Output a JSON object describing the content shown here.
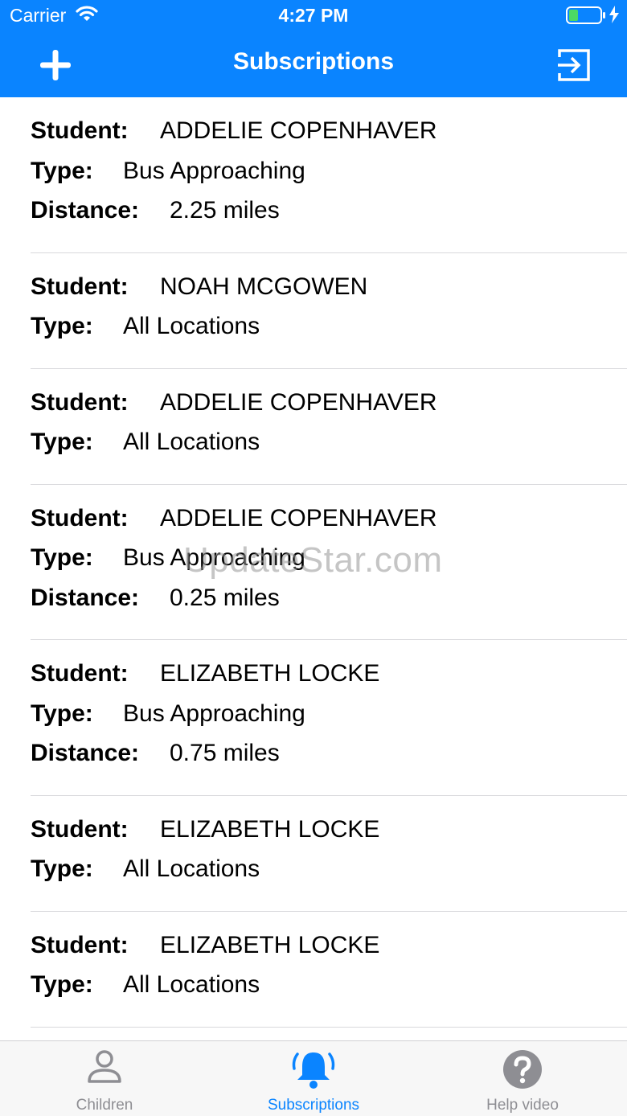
{
  "status_bar": {
    "carrier": "Carrier",
    "time": "4:27 PM"
  },
  "nav": {
    "title": "Subscriptions",
    "add_icon": "plus-icon",
    "exit_icon": "sign-in-icon"
  },
  "labels": {
    "student": "Student:",
    "type": "Type:",
    "distance": "Distance:"
  },
  "subscriptions": [
    {
      "student": "ADDELIE COPENHAVER",
      "type": "Bus Approaching",
      "distance": "2.25 miles"
    },
    {
      "student": "NOAH MCGOWEN",
      "type": "All Locations"
    },
    {
      "student": "ADDELIE COPENHAVER",
      "type": "All Locations"
    },
    {
      "student": "ADDELIE COPENHAVER",
      "type": "Bus Approaching",
      "distance": "0.25 miles"
    },
    {
      "student": "ELIZABETH LOCKE",
      "type": "Bus Approaching",
      "distance": "0.75 miles"
    },
    {
      "student": "ELIZABETH LOCKE",
      "type": "All Locations"
    },
    {
      "student": "ELIZABETH LOCKE",
      "type": "All Locations"
    }
  ],
  "watermark": "UpdateStar.com",
  "tabs": [
    {
      "label": "Children",
      "icon": "person-icon",
      "active": false
    },
    {
      "label": "Subscriptions",
      "icon": "bell-icon",
      "active": true
    },
    {
      "label": "Help video",
      "icon": "question-icon",
      "active": false
    }
  ],
  "colors": {
    "accent": "#0a84ff",
    "inactive": "#8e8e93",
    "divider": "#d9d9dc"
  }
}
